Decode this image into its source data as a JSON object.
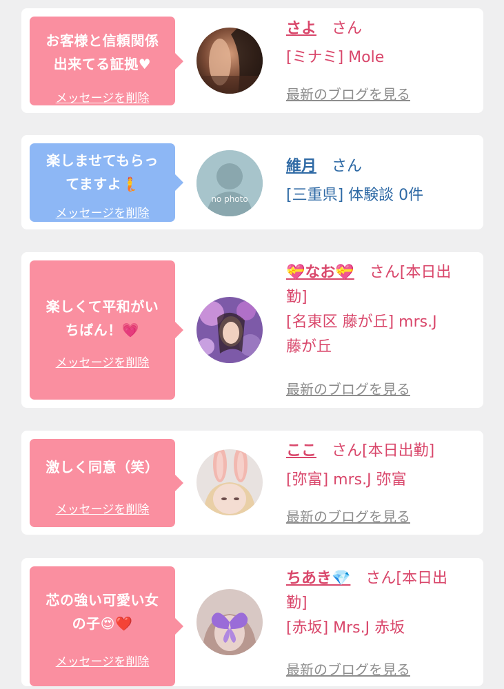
{
  "delete_label": "メッセージを削除",
  "blog_label": "最新のブログを見る",
  "colors": {
    "pink": "#fa8fa0",
    "blue": "#8db7f5",
    "name_pink": "#d9476b",
    "name_blue": "#2f6aa5",
    "background": "#efeff0"
  },
  "entries": [
    {
      "message_line1": "お客様と信頼関係",
      "message_line2": "出来てる証拠♥",
      "name": "さよ",
      "suffix": "さん",
      "shop": "[ミナミ] Mole",
      "bubble_color": "pink"
    },
    {
      "message_line1": "楽しませてもらっ",
      "message_line2": "てますよ🧜",
      "name": "維月",
      "suffix": "さん",
      "shop": "[三重県] 体験談 0件",
      "avatar_text": "no photo",
      "bubble_color": "blue"
    },
    {
      "message_line1": "楽しくて平和がい",
      "message_line2": "ちばん！💗",
      "name": "💝なお💝",
      "suffix": "さん[本日出",
      "suffix2": "勤]",
      "shop": "[名東区 藤が丘] mrs.J",
      "shop2": "藤が丘",
      "bubble_color": "pink"
    },
    {
      "message_line1": "激しく同意（笑）",
      "name": "ここ",
      "suffix": "さん[本日出勤]",
      "shop": "[弥富] mrs.J 弥富",
      "bubble_color": "pink"
    },
    {
      "message_line1": "芯の強い可愛い女",
      "message_line2": "の子😍❤️",
      "name": "ちあき💎",
      "suffix": "さん[本日出",
      "suffix2": "勤]",
      "shop": "[赤坂] Mrs.J 赤坂",
      "bubble_color": "pink"
    }
  ]
}
